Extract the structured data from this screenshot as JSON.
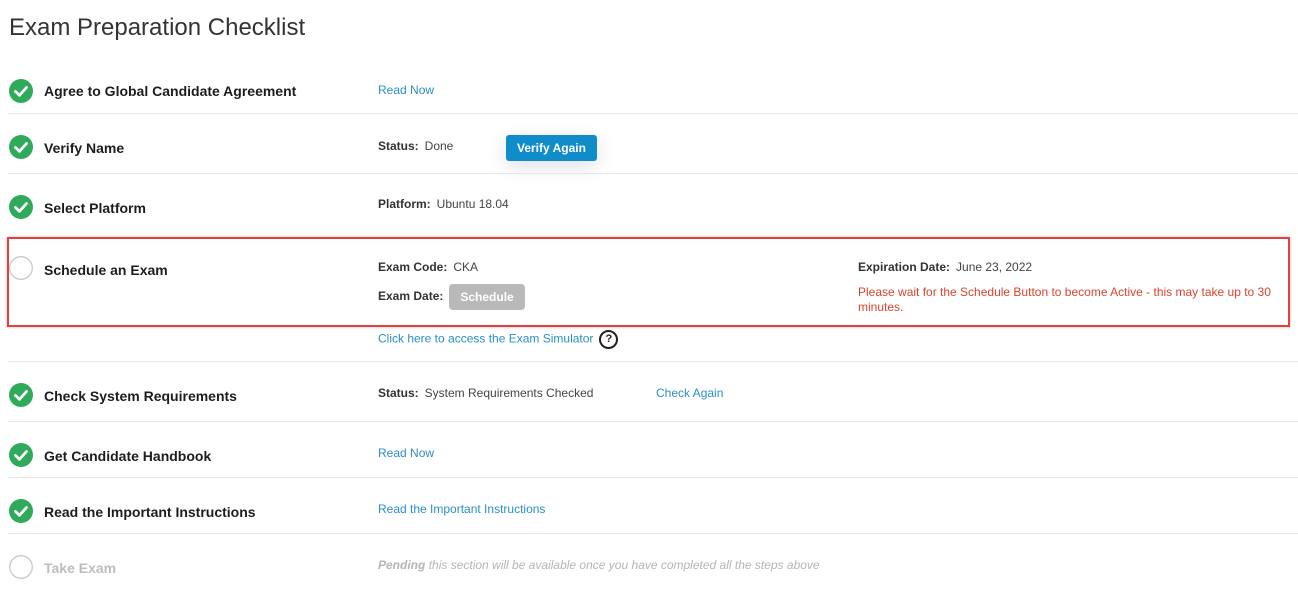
{
  "page": {
    "title": "Exam Preparation Checklist"
  },
  "steps": {
    "agreement": {
      "label": "Agree to Global Candidate Agreement",
      "link": "Read Now"
    },
    "verify_name": {
      "label": "Verify Name",
      "status_key": "Status:",
      "status_value": "Done",
      "button": "Verify Again"
    },
    "platform": {
      "label": "Select Platform",
      "key": "Platform:",
      "value": "Ubuntu 18.04"
    },
    "schedule": {
      "label": "Schedule an Exam",
      "exam_code_key": "Exam Code:",
      "exam_code_value": "CKA",
      "exam_date_key": "Exam Date:",
      "schedule_button": "Schedule",
      "expiration_key": "Expiration Date:",
      "expiration_value": "June 23, 2022",
      "warning": "Please wait for the Schedule Button to become Active - this may take up to 30 minutes.",
      "simulator_link": "Click here to access the Exam Simulator",
      "help_glyph": "?"
    },
    "system": {
      "label": "Check System Requirements",
      "status_key": "Status:",
      "status_value": "System Requirements Checked",
      "link": "Check Again"
    },
    "handbook": {
      "label": "Get Candidate Handbook",
      "link": "Read Now"
    },
    "instructions": {
      "label": "Read the Important Instructions",
      "link": "Read the Important Instructions"
    },
    "take_exam": {
      "label": "Take Exam",
      "pending_bold": "Pending",
      "pending_text": "this section will be available once you have completed all the steps above"
    }
  },
  "colors": {
    "check_green": "#2eaa5a",
    "link": "#2a8fc6",
    "warning": "#d9442f",
    "highlight_border": "#e53e3e",
    "button_blue": "#118ccb",
    "button_disabled": "#b9b9b9"
  },
  "icons": {
    "done": "check-circle-icon",
    "pending": "empty-circle-icon",
    "help": "question-circle-icon"
  }
}
